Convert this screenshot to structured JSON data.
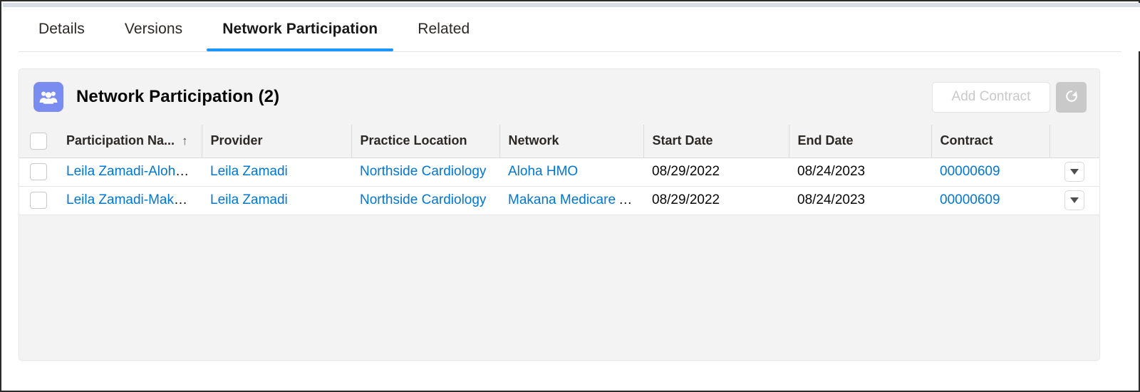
{
  "window": {
    "frame_border_color": "#2b2b2b",
    "chrome_strip_color": "#d8dde6"
  },
  "tabs": {
    "items": [
      {
        "label": "Details",
        "active": false
      },
      {
        "label": "Versions",
        "active": false
      },
      {
        "label": "Network Participation",
        "active": true
      },
      {
        "label": "Related",
        "active": false
      }
    ],
    "active_underline_color": "#1b96ff"
  },
  "card": {
    "icon_name": "groups-icon",
    "icon_background": "#7a8cf0",
    "title": "Network Participation (2)",
    "actions": {
      "add_contract_label": "Add Contract",
      "add_contract_disabled": true,
      "refresh_icon": "refresh-icon"
    }
  },
  "table": {
    "columns": [
      {
        "key": "participation_name",
        "label": "Participation Na...",
        "sorted": true,
        "sort_direction": "ascending",
        "sort_glyph": "↑"
      },
      {
        "key": "provider",
        "label": "Provider"
      },
      {
        "key": "practice_location",
        "label": "Practice Location"
      },
      {
        "key": "network",
        "label": "Network"
      },
      {
        "key": "start_date",
        "label": "Start Date"
      },
      {
        "key": "end_date",
        "label": "End Date"
      },
      {
        "key": "contract",
        "label": "Contract"
      }
    ],
    "rows": [
      {
        "participation_name": "Leila Zamadi-Aloha ...",
        "provider": "Leila Zamadi",
        "practice_location": "Northside Cardiology",
        "network": "Aloha HMO",
        "start_date": "08/29/2022",
        "end_date": "08/24/2023",
        "contract": "00000609"
      },
      {
        "participation_name": "Leila Zamadi-Makan...",
        "provider": "Leila Zamadi",
        "practice_location": "Northside Cardiology",
        "network": "Makana Medicare A...",
        "start_date": "08/29/2022",
        "end_date": "08/24/2023",
        "contract": "00000609"
      }
    ],
    "row_count": 2,
    "link_color": "#0176d3"
  }
}
